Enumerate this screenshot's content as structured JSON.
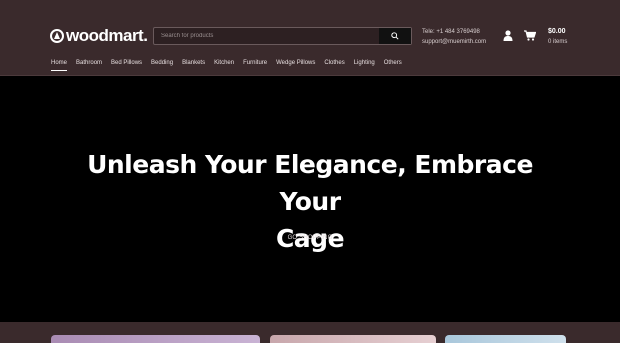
{
  "header": {
    "logo_text": "woodmart.",
    "search_placeholder": "Search for products",
    "contact_phone": "Tele: +1 484 3769498",
    "contact_email": "support@muemirth.com",
    "cart_total": "$0.00",
    "cart_items": "0 items"
  },
  "nav": {
    "items": [
      "Home",
      "Bathroom",
      "Bed Pillows",
      "Bedding",
      "Blankets",
      "Kitchen",
      "Furniture",
      "Wedge Pillows",
      "Clothes",
      "Lighting",
      "Others"
    ],
    "active": "Home"
  },
  "hero": {
    "title_line1": "Unleash Your Elegance, Embrace Your",
    "title_line2": "Cage",
    "cta": "GO SHOPPING"
  },
  "colors": {
    "header_bg": "#3a2a2c",
    "hero_bg": "#000000",
    "card_purple": "#b69bc1",
    "card_pink": "#d9bcc0",
    "card_blue": "#bcd4e4"
  },
  "icons": [
    "logo-mark-icon",
    "search-icon",
    "user-icon",
    "cart-icon"
  ]
}
